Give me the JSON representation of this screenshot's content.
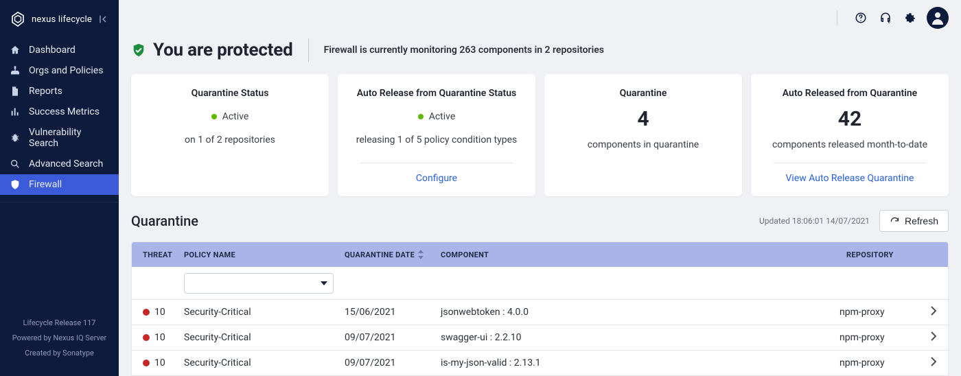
{
  "brand": {
    "name": "nexus lifecycle"
  },
  "sidebar": {
    "items": [
      {
        "label": "Dashboard",
        "icon": "home"
      },
      {
        "label": "Orgs and Policies",
        "icon": "sitemap"
      },
      {
        "label": "Reports",
        "icon": "file"
      },
      {
        "label": "Success Metrics",
        "icon": "bar-chart"
      },
      {
        "label": "Vulnerability Search",
        "icon": "bug"
      },
      {
        "label": "Advanced Search",
        "icon": "search"
      },
      {
        "label": "Firewall",
        "icon": "shield",
        "active": true
      }
    ],
    "footer": {
      "release": "Lifecycle Release 117",
      "powered": "Powered by Nexus IQ Server",
      "created": "Created by Sonatype"
    }
  },
  "hero": {
    "title": "You are protected",
    "subtitle": "Firewall is currently monitoring 263 components in 2 repositories"
  },
  "cards": {
    "quarantine_status": {
      "title": "Quarantine Status",
      "state": "Active",
      "detail": "on 1 of 2 repositories"
    },
    "auto_release_status": {
      "title": "Auto Release from Quarantine Status",
      "state": "Active",
      "detail": "releasing 1 of 5 policy condition types",
      "link": "Configure"
    },
    "quarantine_count": {
      "title": "Quarantine",
      "value": "4",
      "desc": "components in quarantine"
    },
    "auto_released_count": {
      "title": "Auto Released from Quarantine",
      "value": "42",
      "desc": "components released month-to-date",
      "link": "View Auto Release Quarantine"
    }
  },
  "section": {
    "title": "Quarantine",
    "updated": "Updated 18:06:01 14/07/2021",
    "refresh": "Refresh"
  },
  "table": {
    "headers": {
      "threat": "THREAT",
      "policy": "POLICY NAME",
      "date": "QUARANTINE DATE",
      "component": "COMPONENT",
      "repository": "REPOSITORY"
    },
    "rows": [
      {
        "threat": "10",
        "policy": "Security-Critical",
        "date": "15/06/2021",
        "component": "jsonwebtoken : 4.0.0",
        "repository": "npm-proxy"
      },
      {
        "threat": "10",
        "policy": "Security-Critical",
        "date": "09/07/2021",
        "component": "swagger-ui : 2.2.10",
        "repository": "npm-proxy"
      },
      {
        "threat": "10",
        "policy": "Security-Critical",
        "date": "09/07/2021",
        "component": "is-my-json-valid : 2.13.1",
        "repository": "npm-proxy"
      }
    ]
  }
}
